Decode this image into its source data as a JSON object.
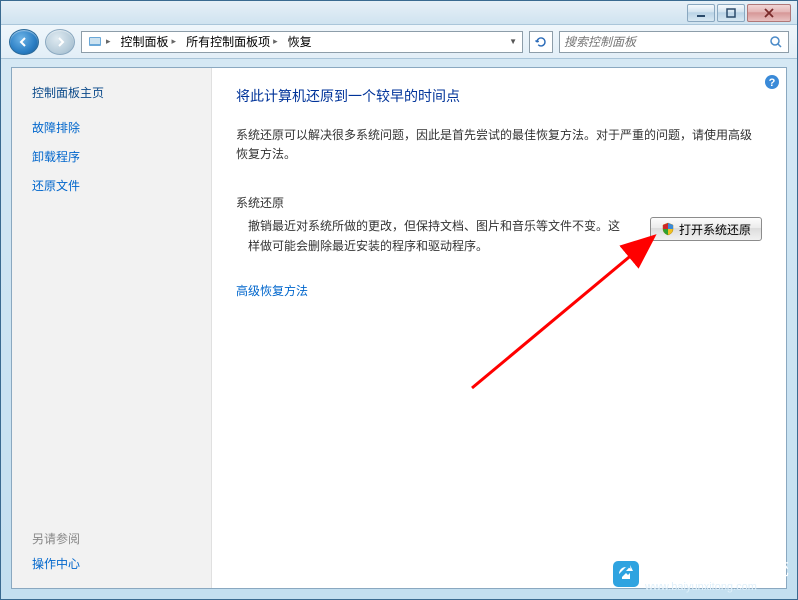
{
  "titlebar": {
    "minimize": "minimize",
    "maximize": "maximize",
    "close": "close"
  },
  "breadcrumb": {
    "item1": "控制面板",
    "item2": "所有控制面板项",
    "item3": "恢复"
  },
  "search": {
    "placeholder": "搜索控制面板"
  },
  "sidebar": {
    "home": "控制面板主页",
    "links": [
      "故障排除",
      "卸载程序",
      "还原文件"
    ],
    "see_also_label": "另请参阅",
    "see_also_link": "操作中心"
  },
  "main": {
    "title": "将此计算机还原到一个较早的时间点",
    "desc": "系统还原可以解决很多系统问题，因此是首先尝试的最佳恢复方法。对于严重的问题，请使用高级恢复方法。",
    "section": "系统还原",
    "restore_text": "撤销最近对系统所做的更改，但保持文档、图片和音乐等文件不变。这样做可能会删除最近安装的程序和驱动程序。",
    "button": "打开系统还原",
    "advanced": "高级恢复方法"
  },
  "watermark": {
    "text": "白云一键重装系统",
    "site": "www.baiyunxitong.com"
  }
}
